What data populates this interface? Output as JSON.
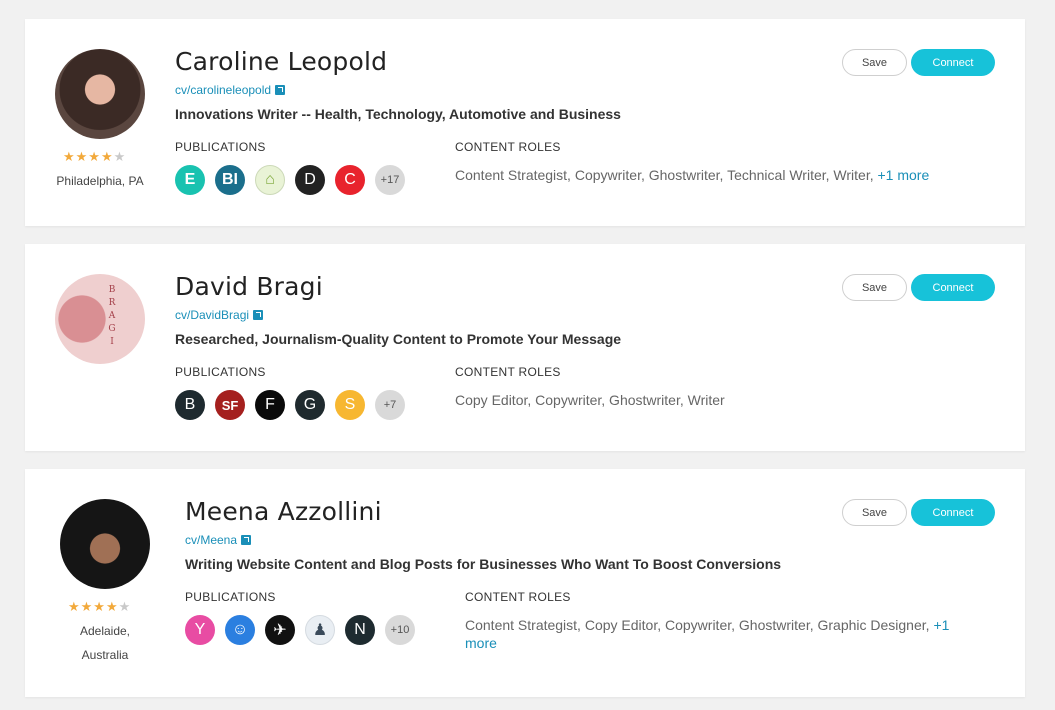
{
  "profiles": [
    {
      "name": "Caroline Leopold",
      "cv_link": "cv/carolineleopold",
      "headline": "Innovations Writer -- Health, Technology, Automotive and Business",
      "rating_stars": "★★★★",
      "rating_half": "★",
      "rating_value": 4.5,
      "location": "Philadelphia, PA",
      "publications_label": "PUBLICATIONS",
      "roles_label": "CONTENT ROLES",
      "publications": [
        {
          "letter": "E",
          "color": "#19c2b0",
          "icon": "engadget-logo-icon"
        },
        {
          "letter": "BI",
          "color": "#1b6f8c",
          "icon": "business-insider-logo-icon"
        },
        {
          "letter": "⌂",
          "color": "#9ac646",
          "icon": "book-logo-icon"
        },
        {
          "letter": "D",
          "color": "#222222",
          "icon": "d-logo-icon"
        },
        {
          "letter": "C",
          "color": "#e8232d",
          "icon": "c-logo-icon"
        }
      ],
      "more_publications": "+17",
      "roles": "Content Strategist, Copywriter, Ghostwriter, Technical Writer, Writer,",
      "roles_more": "+1 more",
      "save_label": "Save",
      "connect_label": "Connect"
    },
    {
      "name": "David Bragi",
      "cv_link": "cv/DavidBragi",
      "headline": "Researched, Journalism-Quality Content to Promote Your Message",
      "avatar_text": "BRAGI",
      "publications_label": "PUBLICATIONS",
      "roles_label": "CONTENT ROLES",
      "publications": [
        {
          "letter": "B",
          "color": "#1e2a2f",
          "icon": "b-logo-icon"
        },
        {
          "letter": "SF",
          "color": "#a5201e",
          "icon": "sfgate-logo-icon"
        },
        {
          "letter": "F",
          "color": "#0a0a0a",
          "icon": "f-logo-icon"
        },
        {
          "letter": "G",
          "color": "#1f2a2e",
          "icon": "g-logo-icon"
        },
        {
          "letter": "S",
          "color": "#f7b731",
          "icon": "s-logo-icon"
        }
      ],
      "more_publications": "+7",
      "roles": "Copy Editor, Copywriter, Ghostwriter, Writer",
      "roles_more": "",
      "save_label": "Save",
      "connect_label": "Connect"
    },
    {
      "name": "Meena Azzollini",
      "cv_link": "cv/Meena",
      "headline": "Writing Website Content and Blog Posts for Businesses Who Want To Boost Conversions",
      "rating_stars": "★★★★",
      "rating_half": "★",
      "rating_value": 4.5,
      "location_line1": "Adelaide,",
      "location_line2": "Australia",
      "publications_label": "PUBLICATIONS",
      "roles_label": "CONTENT ROLES",
      "publications": [
        {
          "letter": "Y",
          "color": "#e84ca3",
          "icon": "y-logo-icon"
        },
        {
          "letter": "☺",
          "color": "#2b7fe0",
          "icon": "robot-logo-icon"
        },
        {
          "letter": "✈",
          "color": "#111111",
          "icon": "bird-logo-icon"
        },
        {
          "letter": "♟",
          "color": "#e9eef3",
          "icon": "figure-logo-icon"
        },
        {
          "letter": "N",
          "color": "#1e2b30",
          "icon": "n-logo-icon"
        }
      ],
      "more_publications": "+10",
      "roles": "Content Strategist, Copy Editor, Copywriter, Ghostwriter, Graphic Designer,",
      "roles_more": "+1 more",
      "save_label": "Save",
      "connect_label": "Connect"
    }
  ]
}
